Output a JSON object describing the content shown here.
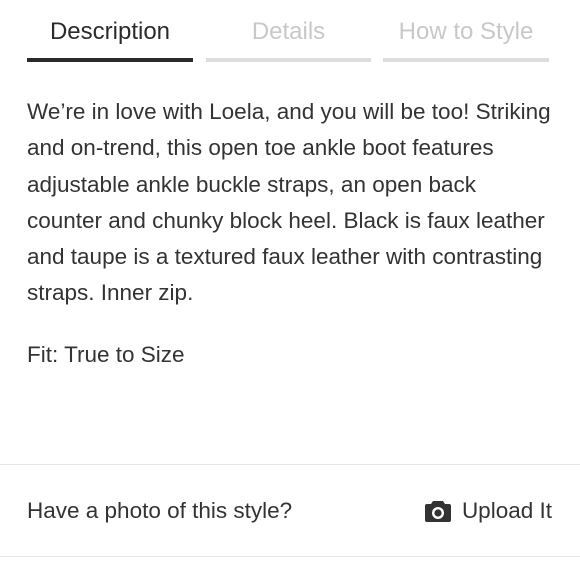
{
  "tabs": [
    {
      "label": "Description",
      "active": true
    },
    {
      "label": "Details",
      "active": false
    },
    {
      "label": "How to Style",
      "active": false
    }
  ],
  "description": {
    "text": "We’re in love with Loela, and you will be too! Striking and on-trend, this open toe ankle boot features adjustable ankle buckle straps, an open back counter and chunky block heel. Black is faux leather and taupe is a textured faux leather with contrasting straps. Inner zip.",
    "fit": "Fit: True to Size"
  },
  "photo": {
    "question": "Have a photo of this style?",
    "upload_label": "Upload It",
    "icon": "camera-icon"
  },
  "colors": {
    "active_tab": "#2b2b2b",
    "inactive_tab": "#c8c8c8",
    "inactive_bar": "#dddddd",
    "text": "#333333"
  }
}
